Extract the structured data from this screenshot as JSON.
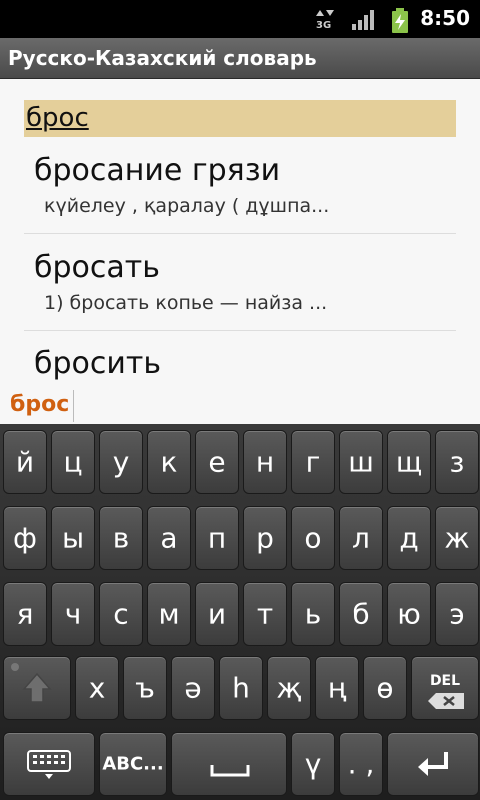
{
  "status": {
    "time": "8:50",
    "network": "3G"
  },
  "app": {
    "title": "Русско-Казахский словарь"
  },
  "search": {
    "query": "брос"
  },
  "entries": [
    {
      "word": "бросание грязи",
      "translation": "күйелеу , қаралау ( дұшпа..."
    },
    {
      "word": "бросать",
      "translation": "1) бросать копье — найза ..."
    },
    {
      "word": "бросить",
      "translation": ""
    }
  ],
  "candidate": {
    "text": "брос"
  },
  "keyboard": {
    "row1": [
      "й",
      "ц",
      "у",
      "к",
      "е",
      "н",
      "г",
      "ш",
      "щ",
      "з"
    ],
    "row2": [
      "ф",
      "ы",
      "в",
      "а",
      "п",
      "р",
      "о",
      "л",
      "д",
      "ж"
    ],
    "row3": [
      "я",
      "ч",
      "с",
      "м",
      "и",
      "т",
      "ь",
      "б",
      "ю",
      "э"
    ],
    "row4": [
      "х",
      "ъ",
      "ә",
      "һ",
      "җ",
      "ң",
      "ө"
    ],
    "del_label": "DEL",
    "abc_label": "ABC...",
    "y_key": "ү",
    "punct_key": ". ,"
  }
}
